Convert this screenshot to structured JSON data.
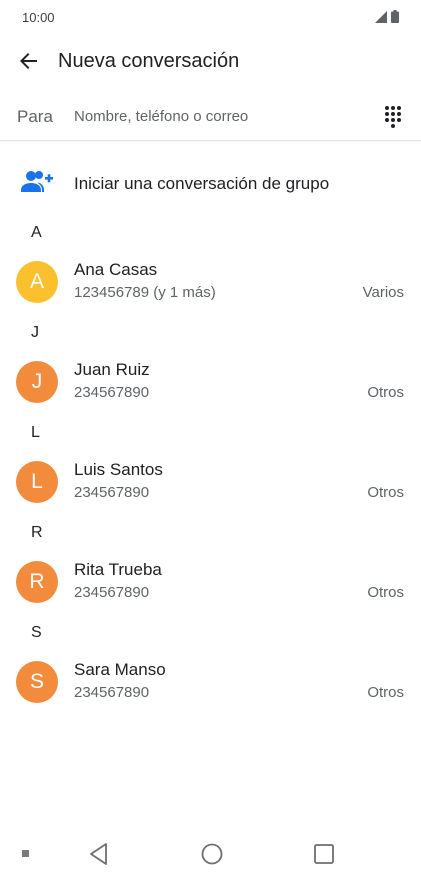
{
  "status_bar": {
    "time": "10:00",
    "icons": [
      "signal-icon",
      "battery-icon"
    ]
  },
  "app_bar": {
    "title": "Nueva conversación",
    "back_icon": "arrow-left-icon"
  },
  "recipient": {
    "label": "Para",
    "placeholder": "Nombre, teléfono o correo",
    "value": "",
    "dialpad_icon": "dialpad-icon"
  },
  "group": {
    "label": "Iniciar una conversación de grupo",
    "icon": "add-group-icon",
    "icon_color": "#1a73e8"
  },
  "sections": [
    {
      "letter": "A",
      "contacts": [
        {
          "initial": "A",
          "name": "Ana Casas",
          "phone": "123456789 (y 1 más)",
          "type": "Varios",
          "color": "#fbc02d"
        }
      ]
    },
    {
      "letter": "J",
      "contacts": [
        {
          "initial": "J",
          "name": "Juan Ruiz",
          "phone": "234567890",
          "type": "Otros",
          "color": "#f28b3c"
        }
      ]
    },
    {
      "letter": "L",
      "contacts": [
        {
          "initial": "L",
          "name": "Luis Santos",
          "phone": "234567890",
          "type": "Otros",
          "color": "#f28b3c"
        }
      ]
    },
    {
      "letter": "R",
      "contacts": [
        {
          "initial": "R",
          "name": "Rita Trueba",
          "phone": "234567890",
          "type": "Otros",
          "color": "#f28b3c"
        }
      ]
    },
    {
      "letter": "S",
      "contacts": [
        {
          "initial": "S",
          "name": "Sara Manso",
          "phone": "234567890",
          "type": "Otros",
          "color": "#f28b3c"
        }
      ]
    }
  ],
  "nav_bar": {
    "icons": [
      "menu-dot-icon",
      "back-triangle-icon",
      "home-circle-icon",
      "recents-square-icon"
    ]
  }
}
